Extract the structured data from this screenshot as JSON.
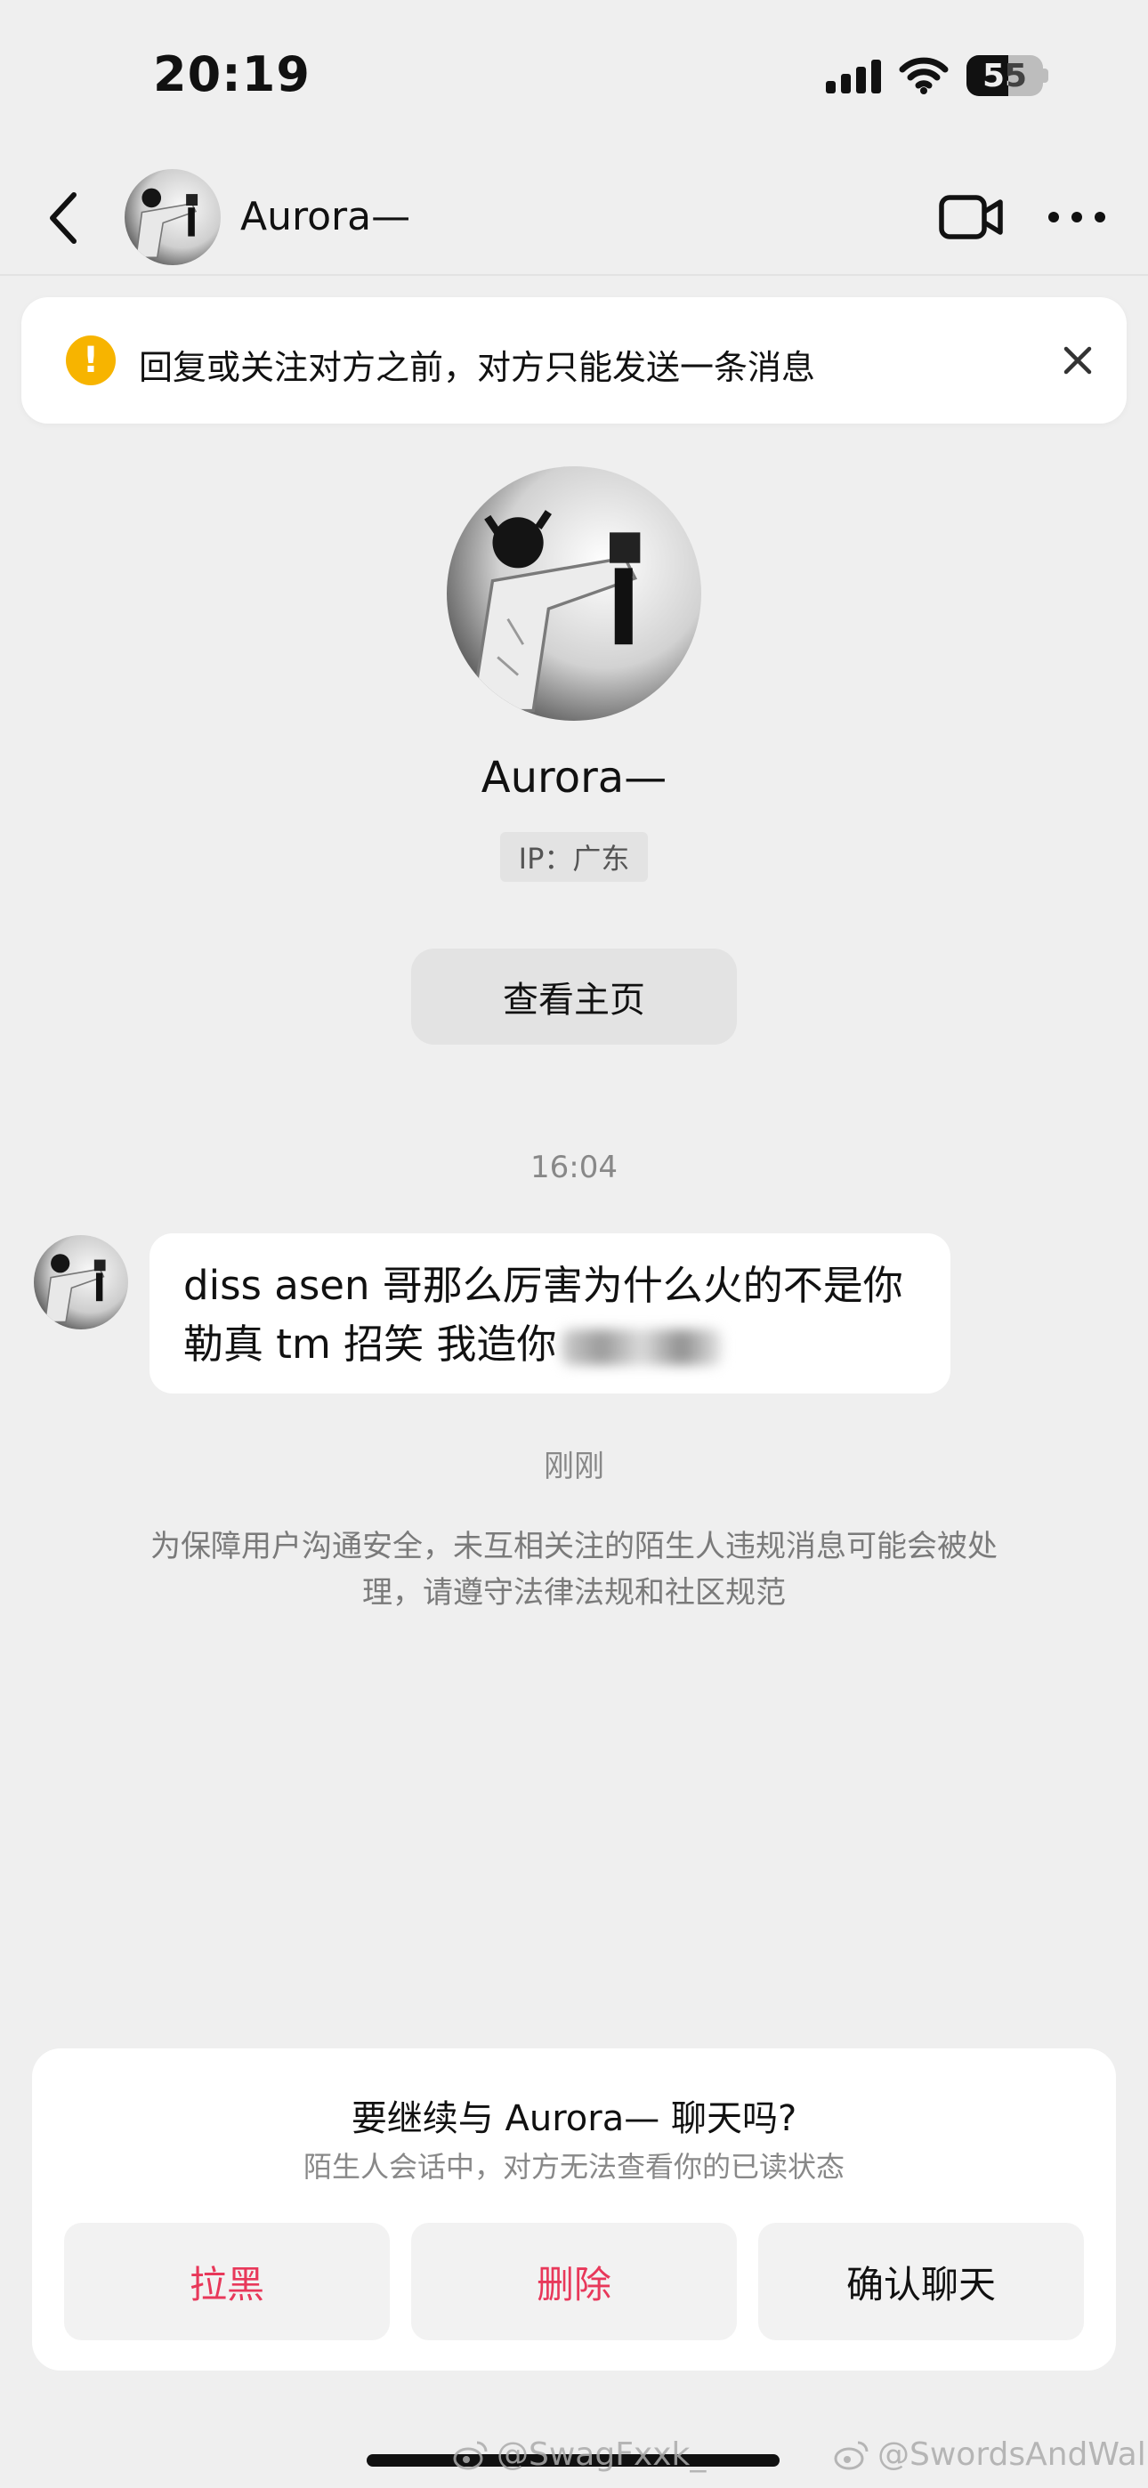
{
  "status_bar": {
    "time": "20:19",
    "battery_level": "55",
    "icons": [
      "signal-icon",
      "wifi-icon",
      "battery-icon"
    ]
  },
  "nav": {
    "back_icon": "chevron-left-icon",
    "name": "Aurora—",
    "video_icon": "video-camera-icon",
    "more_icon": "more-dots-icon"
  },
  "banner": {
    "icon": "exclamation-icon",
    "text": "回复或关注对方之前，对方只能发送一条消息",
    "close_icon": "close-icon",
    "icon_color": "#f7b400"
  },
  "profile": {
    "name": "Aurora—",
    "ip": "IP：广东",
    "view_profile_label": "查看主页"
  },
  "messages": {
    "time_1": "16:04",
    "message_1_text": "diss asen 哥那么厉害为什么火的不是你勒真 tm 招笑 我造你",
    "time_2": "刚刚",
    "safety_notice": "为保障用户沟通安全，未互相关注的陌生人违规消息可能会被处理，请遵守法律法规和社区规范"
  },
  "prompt": {
    "title": "要继续与 Aurora— 聊天吗?",
    "subtitle": "陌生人会话中，对方无法查看你的已读状态",
    "block_label": "拉黑",
    "delete_label": "删除",
    "confirm_label": "确认聊天",
    "danger_color": "#e8385a"
  },
  "watermarks": {
    "left": "@SwagFxxk_",
    "right": "@SwordsAndWalk"
  }
}
